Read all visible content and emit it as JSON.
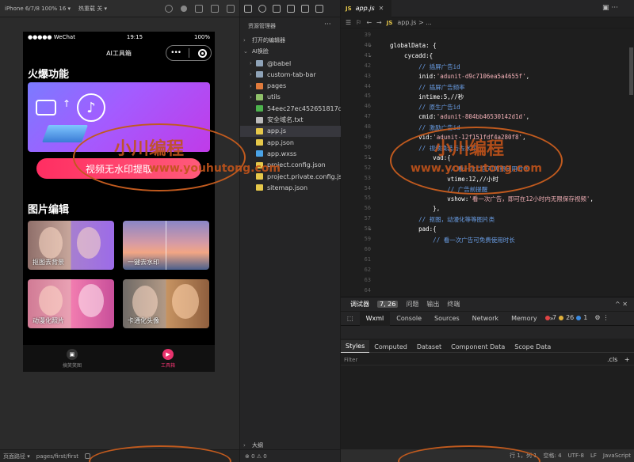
{
  "sim": {
    "device": "iPhone 6/7/8 100% 16 ▾",
    "hotreload": "热重载 关 ▾",
    "footer_path_label": "页面路径 ▾",
    "footer_path": "pages/first/first"
  },
  "phone": {
    "carrier": "●●●●● WeChat",
    "time": "19:15",
    "battery": "100%",
    "nav_title": "AI工具箱",
    "section_hot": "火爆功能",
    "tiktok_glyph": "♪",
    "arrow_glyph": "↑",
    "main_button": "视频无水印提取",
    "section_edit": "图片编辑",
    "tiles": [
      {
        "label": "抠图去背景"
      },
      {
        "label": "一键去水印"
      },
      {
        "label": "动漫化照片"
      },
      {
        "label": "卡通化头像"
      }
    ],
    "tabs": [
      {
        "label": "搞笑笑图",
        "glyph": "▣"
      },
      {
        "label": "工具箱",
        "glyph": "▶"
      }
    ]
  },
  "explorer": {
    "title": "资源管理器",
    "more": "···",
    "section_open": "打开的编辑器",
    "section_project": "AI换脸",
    "items": [
      {
        "name": "@babel",
        "type": "folder",
        "color": "#8fa3b8"
      },
      {
        "name": "custom-tab-bar",
        "type": "folder",
        "color": "#8fa3b8"
      },
      {
        "name": "pages",
        "type": "folder",
        "color": "#e07a3c"
      },
      {
        "name": "utils",
        "type": "folder",
        "color": "#8fc06a"
      },
      {
        "name": "54eec27ec452651817d...",
        "type": "file",
        "color": "#4db34d"
      },
      {
        "name": "安全域名.txt",
        "type": "file",
        "color": "#bbbbbb"
      },
      {
        "name": "app.js",
        "type": "file",
        "color": "#e6c84a"
      },
      {
        "name": "app.json",
        "type": "file",
        "color": "#e6c84a"
      },
      {
        "name": "app.wxss",
        "type": "file",
        "color": "#4aa3e6"
      },
      {
        "name": "project.config.json",
        "type": "file",
        "color": "#e6c84a"
      },
      {
        "name": "project.private.config.js...",
        "type": "file",
        "color": "#e6c84a"
      },
      {
        "name": "sitemap.json",
        "type": "file",
        "color": "#e6c84a"
      }
    ],
    "outline": "大纲",
    "footer": "⊗ 0 ⚠ 0"
  },
  "editor": {
    "tab": "app.js",
    "breadcrumb": "app.js > ...",
    "line_numbers": [
      "39",
      "40",
      "41",
      "42",
      "43",
      "44",
      "45",
      "46",
      "47",
      "48",
      "49",
      "50",
      "51",
      "52",
      "53",
      "54",
      "55",
      "56",
      "57",
      "58",
      "59",
      "60",
      "61",
      "62",
      "63",
      "64"
    ],
    "lines": [
      [],
      [
        {
          "t": "globalData: {",
          "c": "c-key"
        }
      ],
      [
        {
          "t": "    cycadd:{",
          "c": "c-key"
        }
      ],
      [
        {
          "t": "        // 插屏广告id",
          "c": "c-com"
        }
      ],
      [
        {
          "t": "        inid:",
          "c": "c-key"
        },
        {
          "t": "'adunit-d9c7106ea5a4655f'",
          "c": "c-str"
        },
        {
          "t": ",",
          "c": "c-key"
        }
      ],
      [
        {
          "t": "        // 插屏广告频率",
          "c": "c-com"
        }
      ],
      [
        {
          "t": "        intime:5,//秒",
          "c": "c-key"
        }
      ],
      [
        {
          "t": "        // 原生广告id",
          "c": "c-com"
        }
      ],
      [
        {
          "t": "        cmid:",
          "c": "c-key"
        },
        {
          "t": "'adunit-804bb46530142d1d'",
          "c": "c-str"
        },
        {
          "t": ",",
          "c": "c-key"
        }
      ],
      [
        {
          "t": "        // 激励广告id",
          "c": "c-com"
        }
      ],
      [
        {
          "t": "        vid:",
          "c": "c-key"
        },
        {
          "t": "'adunit-12f151fdf4a280f8'",
          "c": "c-str"
        },
        {
          "t": ",",
          "c": "c-key"
        }
      ],
      [
        {
          "t": "        // 视频换装与去水印",
          "c": "c-com"
        }
      ],
      [
        {
          "t": "            vad:{",
          "c": "c-key"
        }
      ],
      [
        {
          "t": "                // 看一次广告可免费使用时长",
          "c": "c-com"
        }
      ],
      [
        {
          "t": "                vtime:12,//小时",
          "c": "c-key"
        }
      ],
      [
        {
          "t": "                // 广告前提醒",
          "c": "c-com"
        }
      ],
      [
        {
          "t": "                vshow:",
          "c": "c-key"
        },
        {
          "t": "'看一次广告，即可在12小时内无限保存视频'",
          "c": "c-str"
        },
        {
          "t": ",",
          "c": "c-key"
        }
      ],
      [
        {
          "t": "            },",
          "c": "c-key"
        }
      ],
      [
        {
          "t": "        // 抠图，动漫化等等图片类",
          "c": "c-com"
        }
      ],
      [
        {
          "t": "        pad:{",
          "c": "c-key"
        }
      ],
      [
        {
          "t": "            // 看一次广告可免费使用时长",
          "c": "c-com"
        }
      ],
      [],
      [],
      [],
      [],
      []
    ],
    "right_icons": "▣ ···"
  },
  "debug": {
    "tabs": [
      "调试器",
      "7, 26",
      "问题",
      "输出",
      "终端"
    ],
    "sub_tabs": [
      "Wxml",
      "Console",
      "Sources",
      "Network",
      "Memory",
      "»"
    ],
    "errors": "7",
    "warnings": "26",
    "infos": "1",
    "style_tabs": [
      "Styles",
      "Computed",
      "Dataset",
      "Component Data",
      "Scope Data"
    ],
    "filter_placeholder": "Filter",
    "cls": ".cls",
    "plus": "+",
    "panel_ctrls": "^  ✕"
  },
  "status_bar": {
    "position": "行 1，列 1",
    "spaces": "空格: 4",
    "encoding": "UTF-8",
    "eol": "LF",
    "language": "JavaScript"
  },
  "watermark": {
    "brand": "小川编程",
    "site": "www.youhutong.com"
  }
}
